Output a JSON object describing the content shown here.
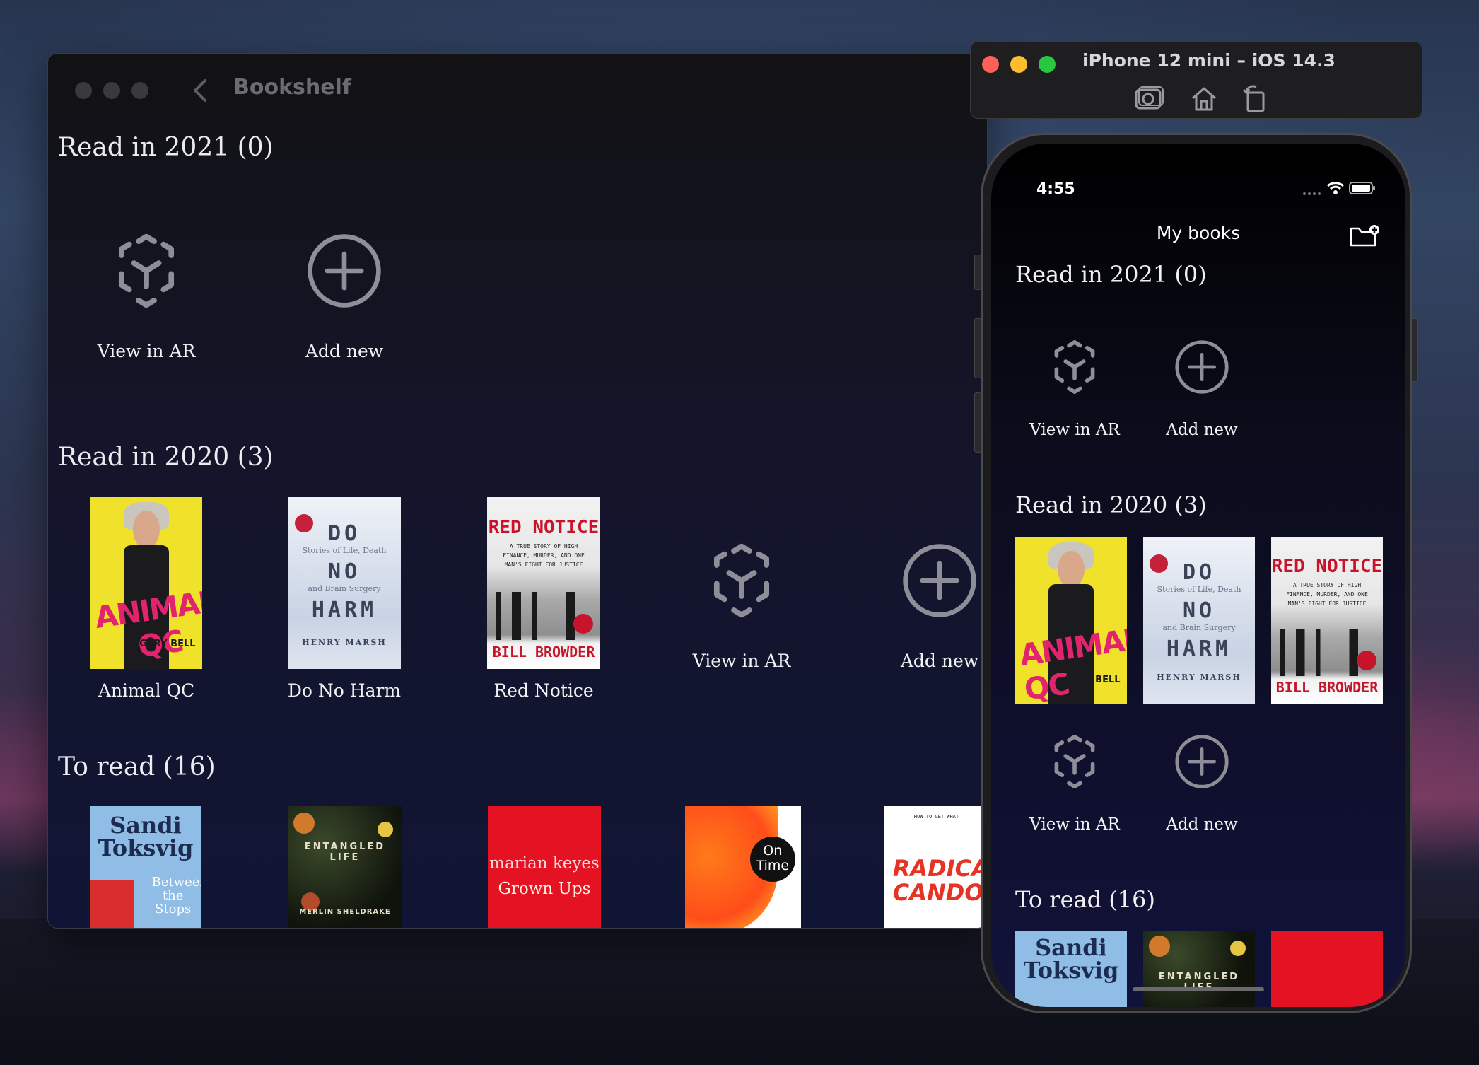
{
  "mac": {
    "title": "Bookshelf",
    "sections": {
      "read2021": "Read in 2021 (0)",
      "read2020": "Read in 2020 (3)",
      "toread": "To read (16)"
    },
    "labels": {
      "view_ar": "View in AR",
      "add_new": "Add new"
    },
    "books_2020": [
      "Animal QC",
      "Do No Harm",
      "Red Notice"
    ]
  },
  "covers": {
    "animal": {
      "title": "ANIMAL QC",
      "author": "GARY BELL"
    },
    "harm": {
      "l1": "DO",
      "l2": "Stories of Life, Death",
      "l3": "NO",
      "l4": "and Brain Surgery",
      "l5": "HARM",
      "author": "HENRY MARSH"
    },
    "red": {
      "title": "RED NOTICE",
      "sub": "A TRUE STORY OF HIGH FINANCE, MURDER, AND ONE MAN'S FIGHT FOR JUSTICE",
      "author": "BILL BROWDER"
    },
    "sandi": {
      "name": "Sandi Toksvig",
      "sub": "Between the Stops"
    },
    "entangled": {
      "title": "ENTANGLED LIFE",
      "author": "MERLIN SHELDRAKE"
    },
    "marian": {
      "author": "marian keyes",
      "title": "Grown Ups"
    },
    "ontime": {
      "title": "On Time"
    },
    "radical": {
      "title": "RADICAL CANDOR",
      "sub": "HOW TO GET WHAT"
    }
  },
  "simulator": {
    "title": "iPhone 12 mini – iOS 14.3",
    "tools": [
      "screenshot-icon",
      "home-icon",
      "rotate-icon"
    ]
  },
  "phone": {
    "time": "4:55",
    "nav_title": "My books",
    "sections": {
      "read2021": "Read in 2021 (0)",
      "read2020": "Read in 2020 (3)",
      "toread": "To read (16)"
    },
    "labels": {
      "view_ar": "View in AR",
      "add_new": "Add new"
    }
  },
  "colors": {
    "icon_gray": "#8e8e99",
    "traffic_red": "#fe5f57",
    "traffic_yellow": "#febc2e",
    "traffic_green": "#28c840"
  }
}
